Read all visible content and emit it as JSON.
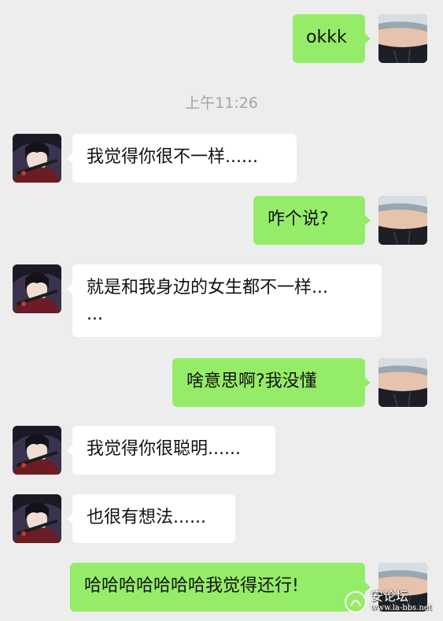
{
  "timestamp": "上午11:26",
  "messages": [
    {
      "side": "out",
      "text": "okkk"
    },
    {
      "side": "in",
      "text": "我觉得你很不一样......"
    },
    {
      "side": "out",
      "text": "咋个说?"
    },
    {
      "side": "in",
      "text": "就是和我身边的女生都不一样...\n..."
    },
    {
      "side": "out",
      "text": "啥意思啊?我没懂"
    },
    {
      "side": "in",
      "text": "我觉得你很聪明......"
    },
    {
      "side": "in",
      "text": "也很有想法......"
    },
    {
      "side": "out",
      "text": "哈哈哈哈哈哈哈我觉得还行!"
    }
  ],
  "watermark": {
    "text": "安论坛",
    "url": "www.la-bbs.net"
  },
  "colors": {
    "background": "#ededed",
    "incoming": "#ffffff",
    "outgoing": "#95ec69",
    "timestamp": "#a5a5a5"
  },
  "icons": {
    "self_avatar": "avatar-photo-belly",
    "contact_avatar": "avatar-anime-character"
  }
}
